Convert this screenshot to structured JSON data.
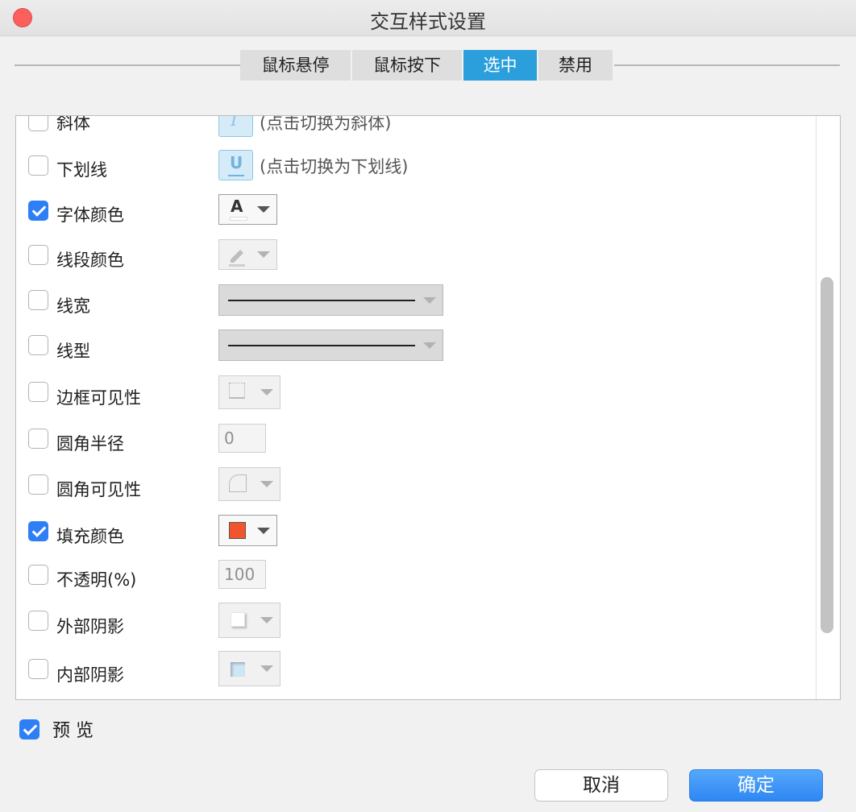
{
  "window": {
    "title": "交互样式设置"
  },
  "tabs": [
    {
      "label": "鼠标悬停",
      "active": false
    },
    {
      "label": "鼠标按下",
      "active": false
    },
    {
      "label": "选中",
      "active": true
    },
    {
      "label": "禁用",
      "active": false
    }
  ],
  "rows": {
    "italic": {
      "label": "斜体",
      "checked": false,
      "hint": "(点击切换为斜体)",
      "glyph": "I"
    },
    "underline": {
      "label": "下划线",
      "checked": false,
      "hint": "(点击切换为下划线)",
      "glyph": "U"
    },
    "font_color": {
      "label": "字体颜色",
      "checked": true,
      "glyph": "A"
    },
    "line_color": {
      "label": "线段颜色",
      "checked": false
    },
    "line_width": {
      "label": "线宽",
      "checked": false
    },
    "line_style": {
      "label": "线型",
      "checked": false
    },
    "border_visibility": {
      "label": "边框可见性",
      "checked": false
    },
    "corner_radius": {
      "label": "圆角半径",
      "checked": false,
      "value": "0"
    },
    "corner_visibility": {
      "label": "圆角可见性",
      "checked": false
    },
    "fill_color": {
      "label": "填充颜色",
      "checked": true,
      "color": "#f2552e"
    },
    "opacity": {
      "label": "不透明(%)",
      "checked": false,
      "value": "100"
    },
    "outer_shadow": {
      "label": "外部阴影",
      "checked": false
    },
    "inner_shadow": {
      "label": "内部阴影",
      "checked": false
    }
  },
  "footer": {
    "preview_label": "预 览",
    "preview_checked": true,
    "cancel_label": "取消",
    "ok_label": "确定"
  },
  "colors": {
    "accent": "#2b9fdc",
    "checkbox": "#2e7ff5",
    "close": "#fc605c"
  }
}
